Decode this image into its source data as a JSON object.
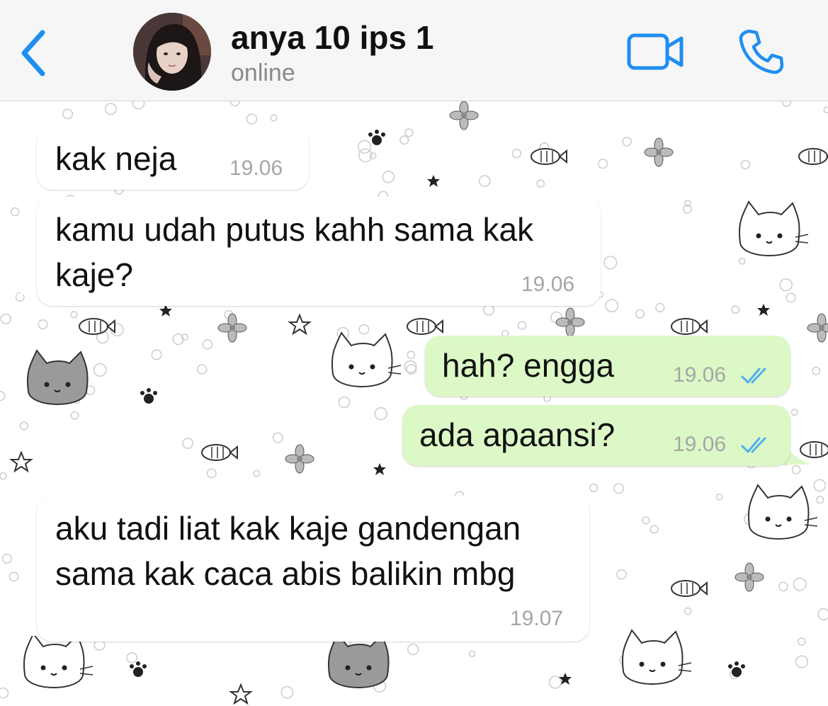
{
  "header": {
    "contact_name": "anya 10 ips 1",
    "status": "online"
  },
  "icons": {
    "back": "chevron-left-icon",
    "video_call": "video-camera-icon",
    "voice_call": "phone-icon",
    "read_receipt": "double-check-icon"
  },
  "colors": {
    "accent": "#1f8ef1",
    "incoming_bubble": "#ffffff",
    "outgoing_bubble": "#dcf8c6",
    "read_ticks": "#4fb0f0",
    "timestamp": "#a6a6a6"
  },
  "messages": [
    {
      "direction": "incoming",
      "lines": [
        "kak neja"
      ],
      "time": "19.06"
    },
    {
      "direction": "incoming",
      "lines": [
        "kamu udah putus kahh sama kak",
        "kaje?"
      ],
      "time": "19.06"
    },
    {
      "direction": "outgoing",
      "lines": [
        "hah? engga"
      ],
      "time": "19.06",
      "status": "read"
    },
    {
      "direction": "outgoing",
      "lines": [
        "ada apaansi?"
      ],
      "time": "19.06",
      "status": "read"
    },
    {
      "direction": "incoming",
      "lines": [
        "aku tadi liat kak kaje gandengan",
        "sama kak caca abis balikin mbg"
      ],
      "time": "19.07"
    }
  ]
}
